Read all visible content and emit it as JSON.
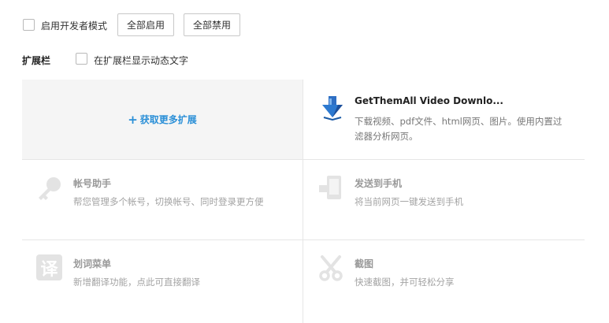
{
  "top": {
    "dev_mode_label": "启用开发者模式",
    "enable_all": "全部启用",
    "disable_all": "全部禁用"
  },
  "section": {
    "title": "扩展栏",
    "dynamic_text_label": "在扩展栏显示动态文字"
  },
  "get_more": {
    "plus": "+",
    "label": "获取更多扩展"
  },
  "extensions": [
    {
      "name": "GetThemAll Video Downlo...",
      "desc_line1": "下载视频、pdf文件、html网页、图片。使用内置过",
      "desc_line2": "滤器分析网页。",
      "icon": "download-arrow-icon",
      "enabled": true
    },
    {
      "name": "帐号助手",
      "desc": "帮您管理多个帐号，切换帐号、同时登录更方便",
      "icon": "key-icon",
      "enabled": false
    },
    {
      "name": "发送到手机",
      "desc": "将当前网页一键发送到手机",
      "icon": "phone-icon",
      "enabled": false
    },
    {
      "name": "划词菜单",
      "desc": "新增翻译功能，点此可直接翻译",
      "icon": "translate-icon",
      "icon_glyph": "译",
      "enabled": false
    },
    {
      "name": "截图",
      "desc": "快速截图，并可轻松分享",
      "icon": "scissors-icon",
      "enabled": false
    }
  ],
  "colors": {
    "accent": "#2a8fd7",
    "disabled_icon": "#e2e2e2"
  }
}
